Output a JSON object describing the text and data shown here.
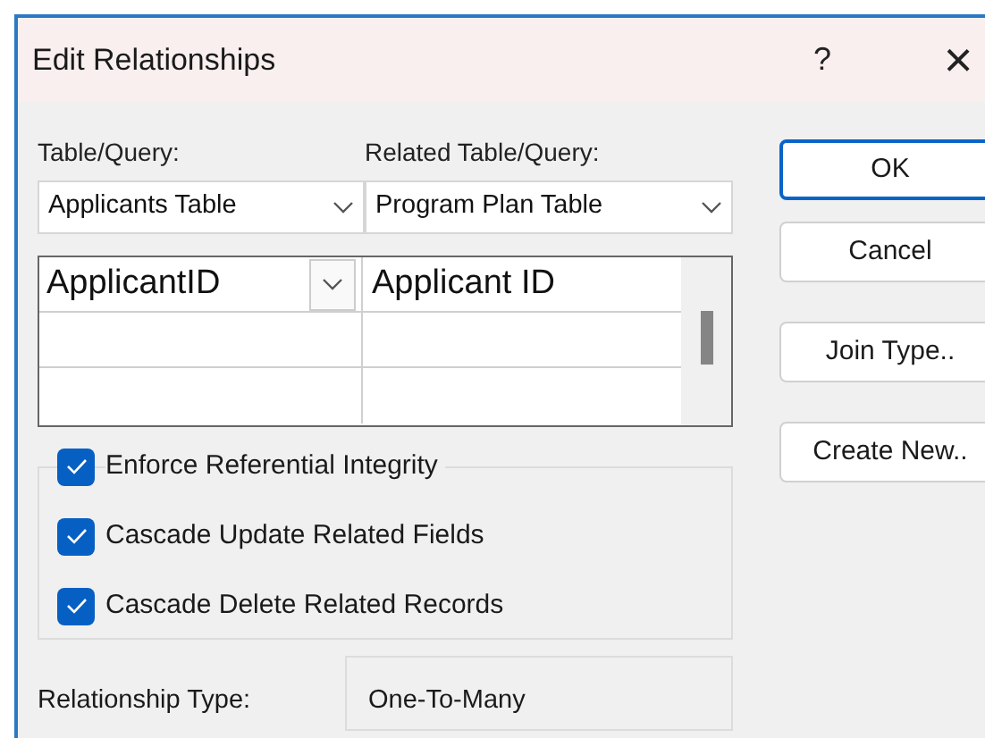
{
  "window": {
    "title": "Edit Relationships",
    "help": "?",
    "close": "×"
  },
  "table_query": {
    "label": "Table/Query:",
    "value": "Applicants Table"
  },
  "related_table_query": {
    "label": "Related Table/Query:",
    "value": "Program Plan Table"
  },
  "fields": {
    "rows": [
      {
        "field": "ApplicantID",
        "related_field": "Applicant ID",
        "selected": true
      },
      {
        "selected": false
      },
      {
        "selected": false
      }
    ]
  },
  "options": [
    {
      "label": "Enforce Referential Integrity",
      "checked": true
    },
    {
      "label": "Cascade Update Related Fields",
      "checked": true
    },
    {
      "label": "Cascade Delete Related Records",
      "checked": true
    }
  ],
  "relationship_type": {
    "label": "Relationship Type:",
    "value": "One-To-Many"
  },
  "buttons": [
    {
      "label": "OK",
      "default": true
    },
    {
      "label": "Cancel",
      "default": false
    },
    {
      "label": "Join Type..",
      "default": false
    },
    {
      "label": "Create New..",
      "default": false
    }
  ]
}
